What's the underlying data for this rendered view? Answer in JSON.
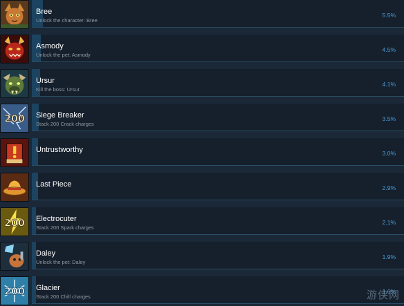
{
  "achievements": [
    {
      "title": "Bree",
      "description": "Unlock the character: Bree",
      "percent": "5.5%",
      "percent_value": 5.5,
      "icon": "cat-character-icon"
    },
    {
      "title": "Asmody",
      "description": "Unlock the pet: Asmody",
      "percent": "4.5%",
      "percent_value": 4.5,
      "icon": "demon-pet-icon"
    },
    {
      "title": "Ursur",
      "description": "Kill the boss: Ursur",
      "percent": "4.1%",
      "percent_value": 4.1,
      "icon": "boss-ursur-icon"
    },
    {
      "title": "Siege Breaker",
      "description": "Stack 200 Crack charges",
      "percent": "3.5%",
      "percent_value": 3.5,
      "icon": "crack-200-icon"
    },
    {
      "title": "Untrustworthy",
      "description": "",
      "percent": "3.0%",
      "percent_value": 3.0,
      "icon": "exclamation-book-icon"
    },
    {
      "title": "Last Piece",
      "description": "",
      "percent": "2.9%",
      "percent_value": 2.9,
      "icon": "hat-icon"
    },
    {
      "title": "Electrocuter",
      "description": "Stack 200 Spark charges",
      "percent": "2.1%",
      "percent_value": 2.1,
      "icon": "spark-200-icon"
    },
    {
      "title": "Daley",
      "description": "Unlock the pet: Daley",
      "percent": "1.9%",
      "percent_value": 1.9,
      "icon": "pet-daley-icon"
    },
    {
      "title": "Glacier",
      "description": "Stack 200 Chill charges",
      "percent": "1.6%",
      "percent_value": 1.6,
      "icon": "chill-200-icon"
    }
  ],
  "icon_badge_text": "200",
  "watermark_text": "游侠网",
  "colors": {
    "background": "#1b2838",
    "panel": "#16202d",
    "progress": "#1c4360",
    "percent": "#4a9fd8",
    "title": "#ffffff",
    "description": "#8f98a0"
  }
}
